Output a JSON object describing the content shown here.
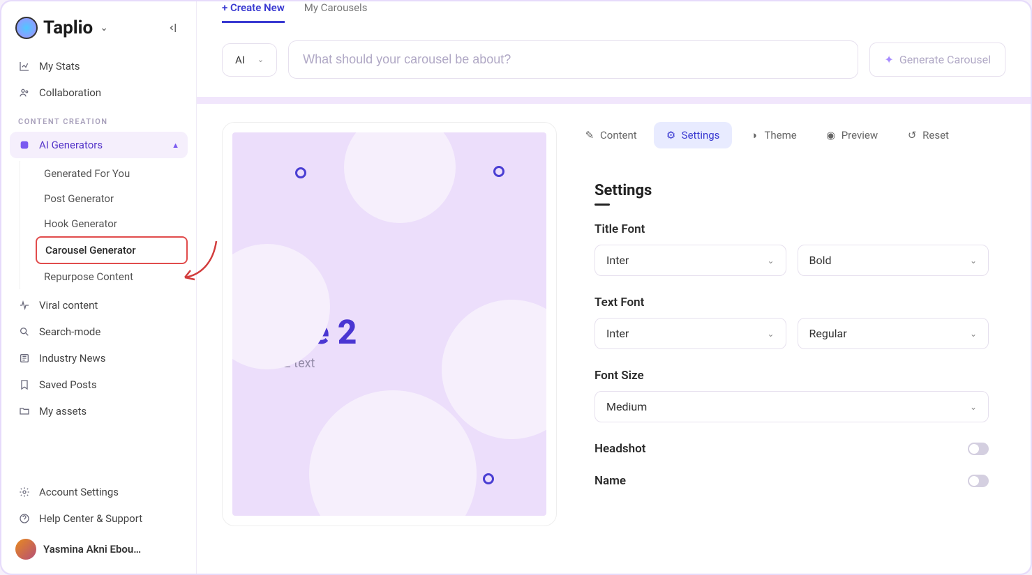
{
  "app": {
    "name": "Taplio"
  },
  "sidebar": {
    "top": [
      {
        "label": "My Stats"
      },
      {
        "label": "Collaboration"
      }
    ],
    "section_label": "CONTENT CREATION",
    "ai_generators_label": "AI Generators",
    "sub": [
      {
        "label": "Generated For You"
      },
      {
        "label": "Post Generator"
      },
      {
        "label": "Hook Generator"
      },
      {
        "label": "Carousel Generator"
      },
      {
        "label": "Repurpose Content"
      }
    ],
    "rest": [
      {
        "label": "Viral content"
      },
      {
        "label": "Search-mode"
      },
      {
        "label": "Industry News"
      },
      {
        "label": "Saved Posts"
      },
      {
        "label": "My assets"
      }
    ],
    "footer": [
      {
        "label": "Account Settings"
      },
      {
        "label": "Help Center & Support"
      }
    ],
    "user_name": "Yasmina Akni Ebou…"
  },
  "tabs": {
    "create_new": "+ Create New",
    "my_carousels": "My Carousels"
  },
  "topbar": {
    "ai_label": "AI",
    "search_placeholder": "What should your carousel be about?",
    "generate_label": "Generate Carousel"
  },
  "panel_tabs": {
    "content": "Content",
    "settings": "Settings",
    "theme": "Theme",
    "preview": "Preview",
    "reset": "Reset"
  },
  "slide": {
    "number": "2",
    "title": "Slide 2",
    "text": "Slide 2 text"
  },
  "settings": {
    "heading": "Settings",
    "title_font_label": "Title Font",
    "title_font_family": "Inter",
    "title_font_weight": "Bold",
    "text_font_label": "Text Font",
    "text_font_family": "Inter",
    "text_font_weight": "Regular",
    "font_size_label": "Font Size",
    "font_size_value": "Medium",
    "headshot_label": "Headshot",
    "name_label": "Name"
  }
}
